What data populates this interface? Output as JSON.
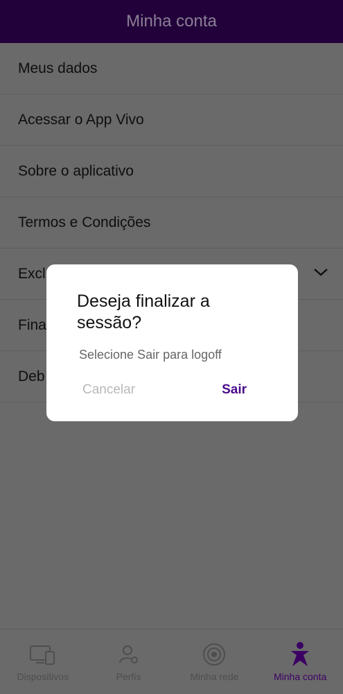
{
  "header": {
    "title": "Minha conta"
  },
  "menu": {
    "items": [
      {
        "label": "Meus dados"
      },
      {
        "label": "Acessar o App Vivo"
      },
      {
        "label": "Sobre o aplicativo"
      },
      {
        "label": "Termos e Condições"
      },
      {
        "label": "Excl"
      },
      {
        "label": "Fina"
      },
      {
        "label": "Deb"
      }
    ]
  },
  "dialog": {
    "title": "Deseja finalizar a sessão?",
    "message": "Selecione Sair para logoff",
    "cancel_label": "Cancelar",
    "confirm_label": "Sair"
  },
  "bottom_nav": {
    "items": [
      {
        "label": "Dispositivos",
        "icon": "devices-icon"
      },
      {
        "label": "Perfis",
        "icon": "profiles-icon"
      },
      {
        "label": "Minha rede",
        "icon": "network-icon"
      },
      {
        "label": "Minha conta",
        "icon": "vivo-person-icon",
        "active": true
      }
    ]
  },
  "colors": {
    "header_bg": "#22003a",
    "accent": "#4a0a8a",
    "overlay": "#6a6a6a"
  }
}
